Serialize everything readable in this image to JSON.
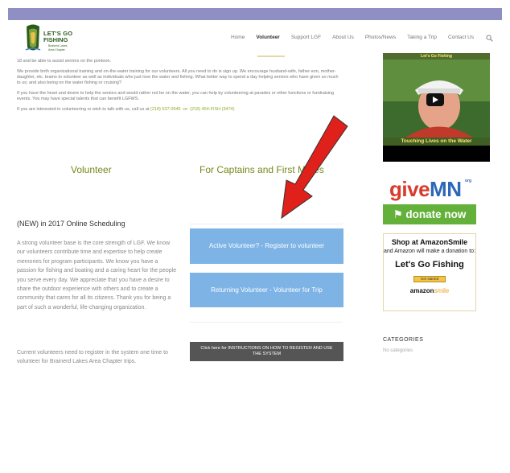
{
  "topbar": {
    "left_text": "",
    "right_text": ""
  },
  "logo": {
    "line1": "LET'S GO",
    "line2": "FISHING",
    "line3": "Brainerd Lakes",
    "line4": "Area Chapter"
  },
  "nav": {
    "items": [
      {
        "label": "Home"
      },
      {
        "label": "Volunteer"
      },
      {
        "label": "Support LGF"
      },
      {
        "label": "About Us"
      },
      {
        "label": "Photos/News"
      },
      {
        "label": "Taking a Trip"
      },
      {
        "label": "Contact Us"
      }
    ]
  },
  "intro": {
    "p1": "18 and be able to assist seniors on the pontoon.",
    "p2": "We provide both organizational training and on-the-water training for our volunteers.  All you need to do is sign up.  We encourage husband-wife, father-son, mother-daughter, etc. teams to volunteer as well as individuals who just love the water and fishing.  What better way to spend a day helping seniors who have given so much to us; and also being on the water fishing or cruising?",
    "p3": "If you have the heart and desire to help the seniors and would rather not be on the water, you can help by volunteering at parades or other functions or fundraising events. You may have special talents that can benefit LGFWS.",
    "p4_prefix": "If you are interested in volunteering or wish to talk with us, call us at ",
    "p4_phones": "(218) 537-0945  -or- (218) 454-FISH (3474)"
  },
  "columns": {
    "volunteer_title": "Volunteer",
    "captains_title": "For Captains and First Mates"
  },
  "schedule": {
    "title": "(NEW) in 2017 Online Scheduling",
    "para1": "A strong volunteer base is the core strength of LGF. We know our volunteers contribute time and expertise to help create memories for program participants. We know you have a passion for fishing and boating and a caring heart for the people you serve every day. We appreciate that you have a desire to share the outdoor experience with others and to create a community that cares for all its citizens. Thank you for being a part of such a wonderful, life-changing organization.",
    "para2": "Current volunteers need to register in the system one time to volunteer for Brainerd Lakes Area Chapter trips."
  },
  "buttons": {
    "active_volunteer": "Active Volunteer? - Register to volunteer",
    "returning_volunteer": "Returning Volunteer - Volunteer for Trip",
    "instructions": "Click here for INSTRUCTIONS ON HOW TO REGISTER AND USE THE SYSTEM"
  },
  "video": {
    "caption_top": "Let's Go Fishing",
    "caption_bottom": "Touching Lives on the Water"
  },
  "givemn": {
    "give": "give",
    "mn": "MN",
    "org": "org",
    "donate": "donate now"
  },
  "amazon": {
    "title": "Shop at AmazonSmile",
    "line": "and Amazon will make a donation to:",
    "org": "Let's Go Fishing",
    "button": "Get started",
    "brand": "amazon",
    "brand_smile": "smile"
  },
  "sidebar": {
    "categories_title": "CATEGORIES",
    "categories_empty": "No categories"
  },
  "colors": {
    "accent_green": "#74891c",
    "button_blue": "#7db3e5",
    "arrow_red": "#e0201b"
  }
}
